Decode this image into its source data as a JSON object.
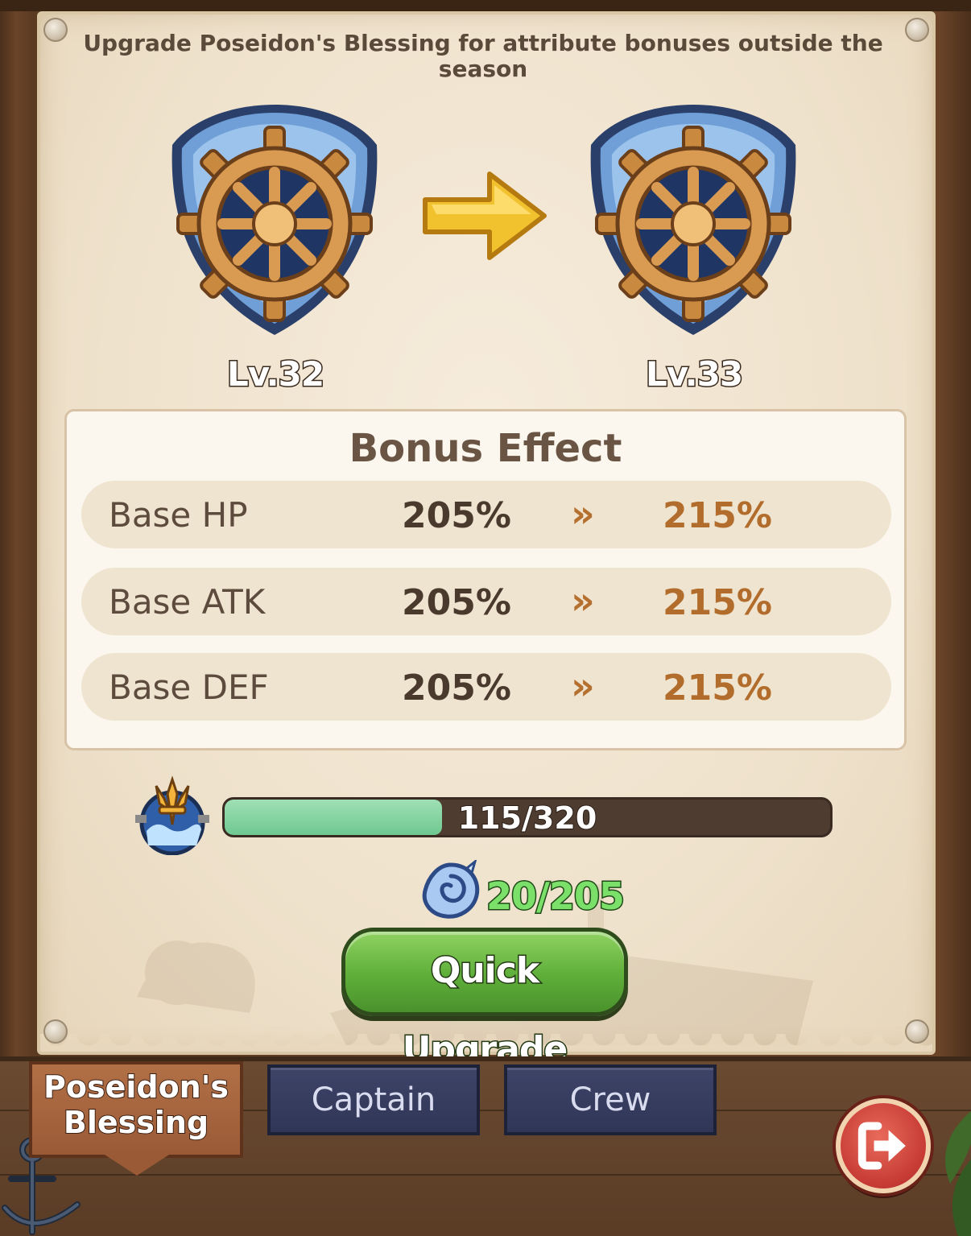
{
  "description": "Upgrade Poseidon's Blessing for attribute bonuses outside the season",
  "emblem": {
    "current_level": "Lv.32",
    "next_level": "Lv.33",
    "icon": "ship-wheel-shield-icon"
  },
  "bonus": {
    "title": "Bonus Effect",
    "rows": [
      {
        "label": "Base HP",
        "from": "205%",
        "arrow": "»",
        "to": "215%"
      },
      {
        "label": "Base ATK",
        "from": "205%",
        "arrow": "»",
        "to": "215%"
      },
      {
        "label": "Base DEF",
        "from": "205%",
        "arrow": "»",
        "to": "215%"
      }
    ]
  },
  "progress": {
    "text": "115/320",
    "current": 115,
    "max": 320
  },
  "cost": {
    "text": "20/205",
    "icon": "shell-icon"
  },
  "quick_upgrade_label": "Quick Upgrade",
  "tabs": {
    "active": "Poseidon's Blessing",
    "captain": "Captain",
    "crew": "Crew"
  },
  "colors": {
    "accent_value": "#b26d2c",
    "button_green": "#5fae3a",
    "progress_fill": "#6fc890",
    "exit_red": "#c63a34"
  }
}
